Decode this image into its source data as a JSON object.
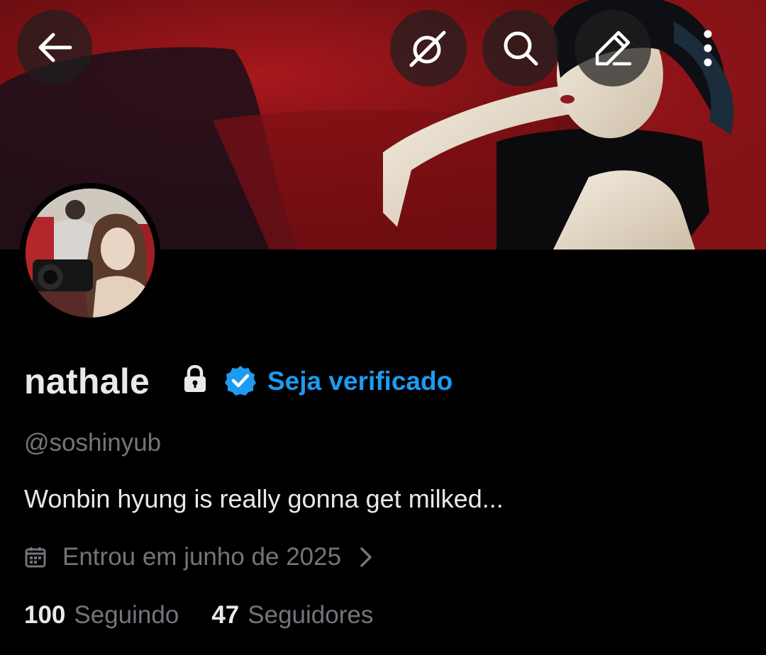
{
  "header": {
    "back_icon": "arrow-left-icon",
    "grok_icon": "grok-icon",
    "search_icon": "search-icon",
    "edit_icon": "pencil-icon",
    "more_icon": "more-vertical-icon"
  },
  "profile": {
    "display_name": "nathale",
    "lock_icon": "lock-icon",
    "verified_badge_icon": "verified-badge-icon",
    "get_verified_label": "Seja verificado",
    "handle": "@soshinyub",
    "bio": "Wonbin hyung is really gonna get milked...",
    "joined": "Entrou em junho de 2025",
    "following_count": "100",
    "following_label": "Seguindo",
    "followers_count": "47",
    "followers_label": "Seguidores"
  },
  "colors": {
    "background": "#000000",
    "primary_text": "#e7e9ea",
    "secondary_text": "#71767b",
    "accent": "#1d9bf0"
  }
}
